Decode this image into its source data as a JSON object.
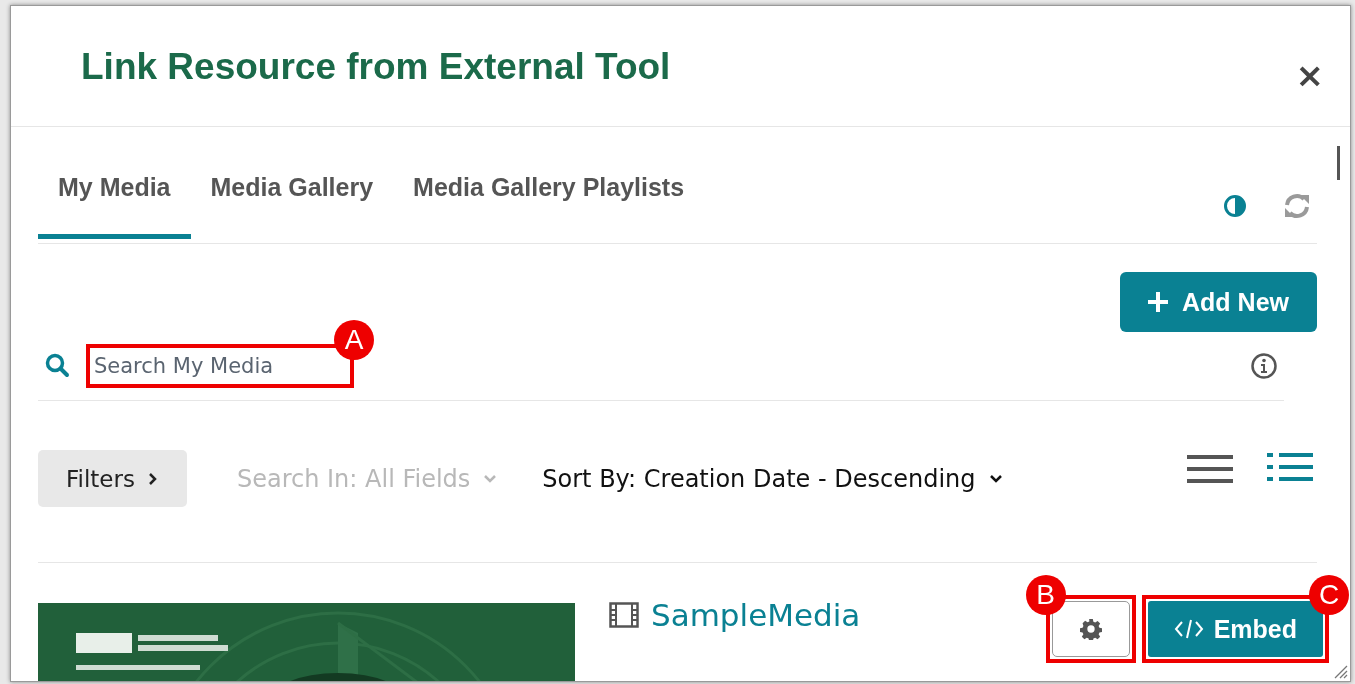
{
  "dialog": {
    "title": "Link Resource from External Tool",
    "close": "×"
  },
  "tabs": [
    {
      "label": "My Media",
      "selected": true
    },
    {
      "label": "Media Gallery",
      "selected": false
    },
    {
      "label": "Media Gallery Playlists",
      "selected": false
    }
  ],
  "add_button": "Add New",
  "search": {
    "placeholder": "Search My Media"
  },
  "filters": {
    "button": "Filters",
    "search_in": "Search In: All Fields",
    "sort_by": "Sort By: Creation Date - Descending"
  },
  "view_modes": [
    {
      "kind": "list",
      "selected": false
    },
    {
      "kind": "detailed",
      "selected": true
    }
  ],
  "media": [
    {
      "title": "SampleMedia",
      "embed": "Embed"
    }
  ],
  "annotations": [
    {
      "label": "A"
    },
    {
      "label": "B"
    },
    {
      "label": "C"
    }
  ]
}
